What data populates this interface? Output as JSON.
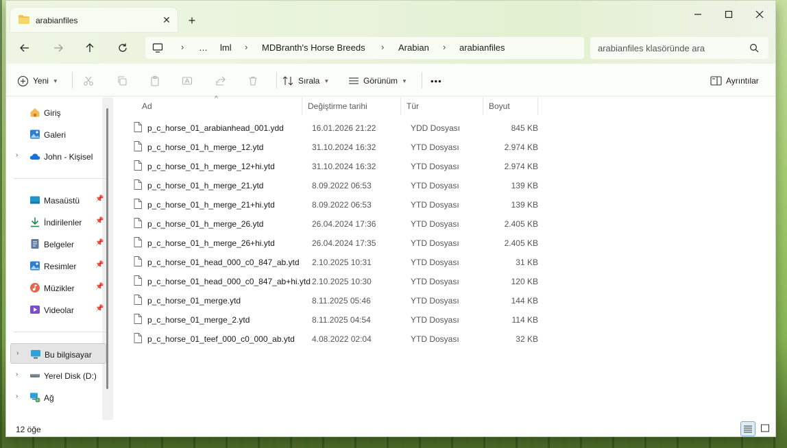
{
  "window": {
    "tab_title": "arabianfiles",
    "new_tab_symbol": "+",
    "close_tab_symbol": "✕"
  },
  "nav": {
    "breadcrumbs": [
      "…",
      "lml",
      "MDBranth's Horse Breeds",
      "Arabian",
      "arabianfiles"
    ],
    "search_placeholder": "arabianfiles klasöründe ara"
  },
  "toolbar": {
    "new_label": "Yeni",
    "sort_label": "Sırala",
    "view_label": "Görünüm",
    "more_label": "•••",
    "details_label": "Ayrıntılar"
  },
  "sidebar": {
    "items": [
      {
        "label": "Giriş",
        "icon": "home-icon"
      },
      {
        "label": "Galeri",
        "icon": "gallery-icon"
      },
      {
        "label": "John - Kişisel",
        "icon": "cloud-icon"
      },
      {
        "label": "Masaüstü",
        "icon": "desktop-icon"
      },
      {
        "label": "İndirilenler",
        "icon": "download-icon"
      },
      {
        "label": "Belgeler",
        "icon": "documents-icon"
      },
      {
        "label": "Resimler",
        "icon": "pictures-icon"
      },
      {
        "label": "Müzikler",
        "icon": "music-icon"
      },
      {
        "label": "Videolar",
        "icon": "videos-icon"
      },
      {
        "label": "Bu bilgisayar",
        "icon": "this-pc-icon"
      },
      {
        "label": "Yerel Disk (D:)",
        "icon": "drive-icon"
      },
      {
        "label": "Ağ",
        "icon": "network-icon"
      }
    ]
  },
  "columns": {
    "name": "Ad",
    "date": "Değiştirme tarihi",
    "type": "Tür",
    "size": "Boyut"
  },
  "files": [
    {
      "name": "p_c_horse_01_arabianhead_001.ydd",
      "date": "16.01.2026 21:22",
      "type": "YDD Dosyası",
      "size": "845 KB"
    },
    {
      "name": "p_c_horse_01_h_merge_12.ytd",
      "date": "31.10.2024 16:32",
      "type": "YTD Dosyası",
      "size": "2.974 KB"
    },
    {
      "name": "p_c_horse_01_h_merge_12+hi.ytd",
      "date": "31.10.2024 16:32",
      "type": "YTD Dosyası",
      "size": "2.974 KB"
    },
    {
      "name": "p_c_horse_01_h_merge_21.ytd",
      "date": "8.09.2022 06:53",
      "type": "YTD Dosyası",
      "size": "139 KB"
    },
    {
      "name": "p_c_horse_01_h_merge_21+hi.ytd",
      "date": "8.09.2022 06:53",
      "type": "YTD Dosyası",
      "size": "139 KB"
    },
    {
      "name": "p_c_horse_01_h_merge_26.ytd",
      "date": "26.04.2024 17:36",
      "type": "YTD Dosyası",
      "size": "2.405 KB"
    },
    {
      "name": "p_c_horse_01_h_merge_26+hi.ytd",
      "date": "26.04.2024 17:35",
      "type": "YTD Dosyası",
      "size": "2.405 KB"
    },
    {
      "name": "p_c_horse_01_head_000_c0_847_ab.ytd",
      "date": "2.10.2025 10:31",
      "type": "YTD Dosyası",
      "size": "31 KB"
    },
    {
      "name": "p_c_horse_01_head_000_c0_847_ab+hi.ytd",
      "date": "2.10.2025 10:30",
      "type": "YTD Dosyası",
      "size": "120 KB"
    },
    {
      "name": "p_c_horse_01_merge.ytd",
      "date": "8.11.2025 05:46",
      "type": "YTD Dosyası",
      "size": "144 KB"
    },
    {
      "name": "p_c_horse_01_merge_2.ytd",
      "date": "8.11.2025 04:54",
      "type": "YTD Dosyası",
      "size": "114 KB"
    },
    {
      "name": "p_c_horse_01_teef_000_c0_000_ab.ytd",
      "date": "4.08.2022 02:04",
      "type": "YTD Dosyası",
      "size": "32 KB"
    }
  ],
  "status": {
    "count": "12 öğe"
  },
  "colors": {
    "accent": "#0067c0",
    "folder": "#f2c54a"
  }
}
